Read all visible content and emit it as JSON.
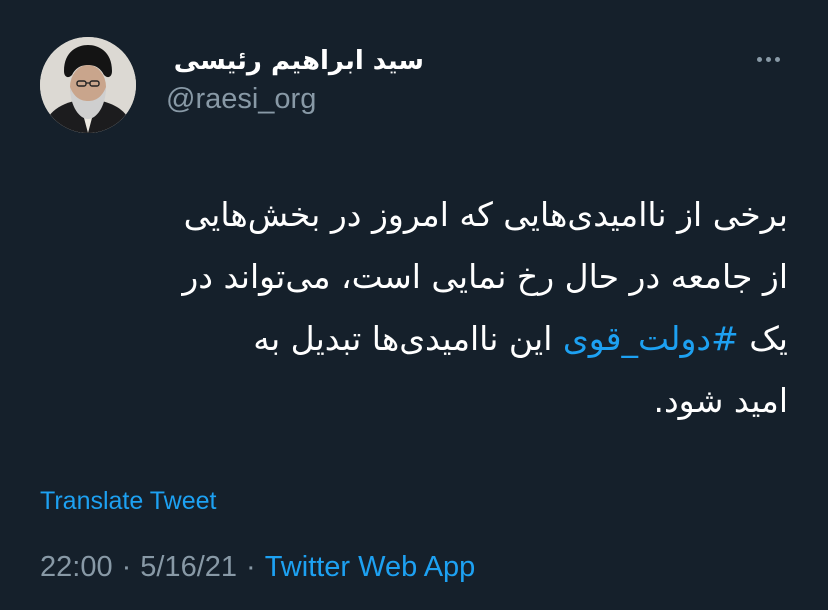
{
  "author": {
    "display_name": "سید ابراهیم رئیسی",
    "handle": "@raesi_org",
    "avatar_icon": "profile-photo"
  },
  "more_icon": "more-horizontal-icon",
  "tweet": {
    "lines": [
      {
        "before": "برخی از ناامیدی‌هایی که امروز در بخش‌هایی",
        "hashtag": "",
        "after": ""
      },
      {
        "before": "از جامعه در حال رخ نمایی است، می‌تواند در",
        "hashtag": "",
        "after": ""
      },
      {
        "before": "یک ",
        "hashtag": "#دولت_قوی",
        "after": " این ناامیدی‌ها تبدیل به"
      },
      {
        "before": "امید شود.",
        "hashtag": "",
        "after": ""
      }
    ]
  },
  "translate_label": "Translate Tweet",
  "meta": {
    "time": "22:00",
    "separator": "·",
    "date": "5/16/21",
    "source": "Twitter Web App"
  },
  "colors": {
    "background": "#15202b",
    "text": "#ffffff",
    "secondary": "#8899a6",
    "accent": "#1da1f2"
  }
}
